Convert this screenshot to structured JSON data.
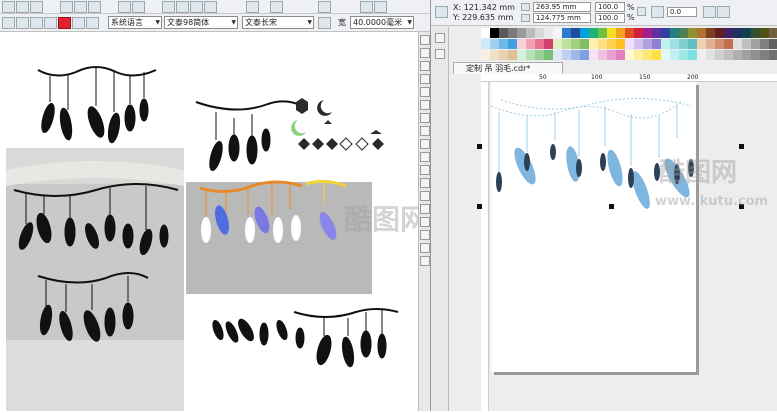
{
  "toolbar": {
    "font_lang": "系统语言",
    "font_name": "文泰98简体",
    "font_style": "文泰长宋",
    "width_label": "宽",
    "width_value": "40.0000毫米"
  },
  "properties": {
    "x": "X: 121.342 mm",
    "y": "Y: 229.635 mm",
    "w": "263.95 mm",
    "h": "124.775 mm",
    "scale_x": "100.0",
    "scale_y": "100.0",
    "pct": "%",
    "rotation": "0.0"
  },
  "document_tab": "定制 吊 羽毛.cdr*",
  "ruler_top": [
    "50",
    "100",
    "150",
    "200"
  ],
  "watermarks": [
    "酷图网",
    "www.ikutu.com"
  ],
  "colors": {
    "feather_blue": "#7fb6e0",
    "feather_dark": "#2b3f55",
    "accent_orange": "#e98a2a",
    "accent_purple": "#7b78e6"
  }
}
